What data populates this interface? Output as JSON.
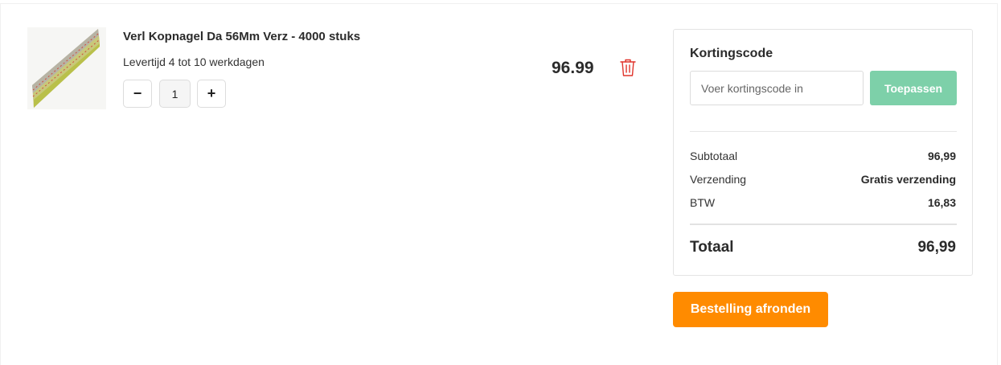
{
  "cart": {
    "item": {
      "image_alt": "nail-strip-image",
      "title": "Verl Kopnagel Da 56Mm Verz - 4000 stuks",
      "delivery": "Levertijd 4 tot 10 werkdagen",
      "quantity": "1",
      "qty_minus": "−",
      "qty_plus": "+",
      "price": "96.99",
      "delete_icon": "trash-icon"
    }
  },
  "summary": {
    "coupon": {
      "title": "Kortingscode",
      "placeholder": "Voer kortingscode in",
      "value": "",
      "apply_label": "Toepassen"
    },
    "rows": [
      {
        "label": "Subtotaal",
        "value": "96,99"
      },
      {
        "label": "Verzending",
        "value": "Gratis verzending"
      },
      {
        "label": "BTW",
        "value": "16,83"
      }
    ],
    "total": {
      "label": "Totaal",
      "value": "96,99"
    },
    "checkout_label": "Bestelling afronden"
  },
  "colors": {
    "accent_orange": "#ff8b00",
    "apply_green": "#7dd0a9",
    "trash_red": "#e0332b"
  }
}
